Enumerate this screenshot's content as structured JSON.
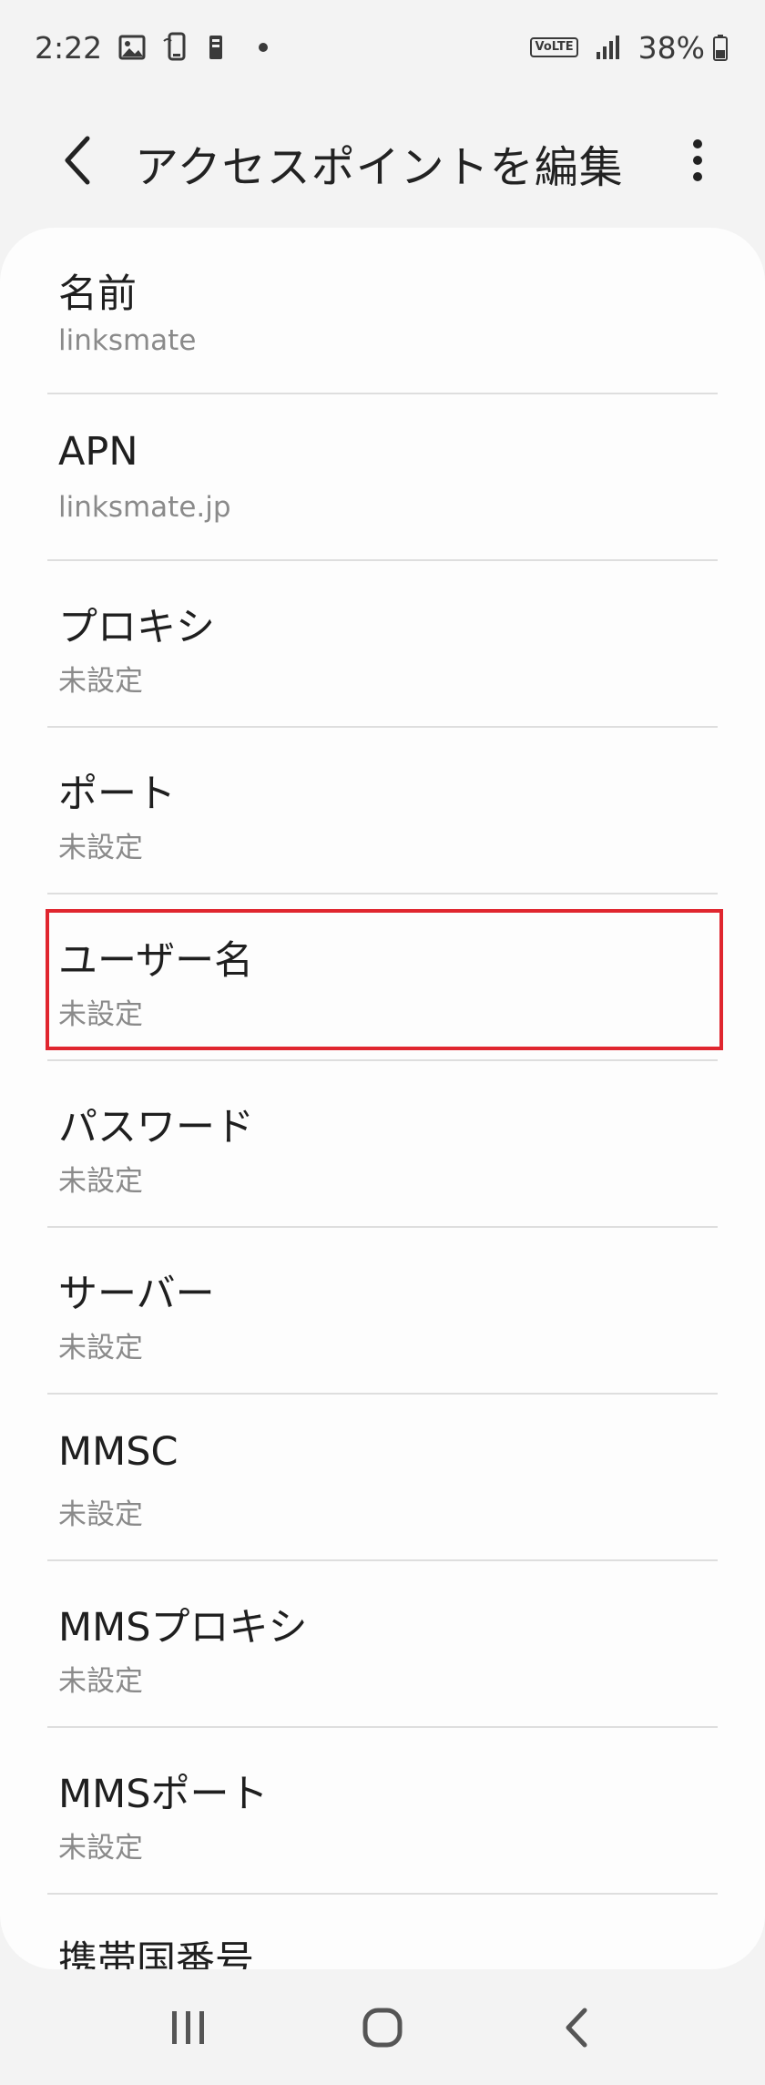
{
  "status_bar": {
    "time": "2:22",
    "battery": "38%",
    "network_badge": "VoLTE"
  },
  "app_bar": {
    "title": "アクセスポイントを編集"
  },
  "items": [
    {
      "label": "名前",
      "value": "linksmate"
    },
    {
      "label": "APN",
      "value": "linksmate.jp"
    },
    {
      "label": "プロキシ",
      "value": "未設定"
    },
    {
      "label": "ポート",
      "value": "未設定"
    },
    {
      "label": "ユーザー名",
      "value": "未設定"
    },
    {
      "label": "パスワード",
      "value": "未設定"
    },
    {
      "label": "サーバー",
      "value": "未設定"
    },
    {
      "label": "MMSC",
      "value": "未設定"
    },
    {
      "label": "MMSプロキシ",
      "value": "未設定"
    },
    {
      "label": "MMSポート",
      "value": "未設定"
    },
    {
      "label": "携帯国番号",
      "value": ""
    }
  ],
  "colors": {
    "highlight": "#e0262f",
    "background": "#f3f3f3",
    "card": "#fdfdfd"
  }
}
